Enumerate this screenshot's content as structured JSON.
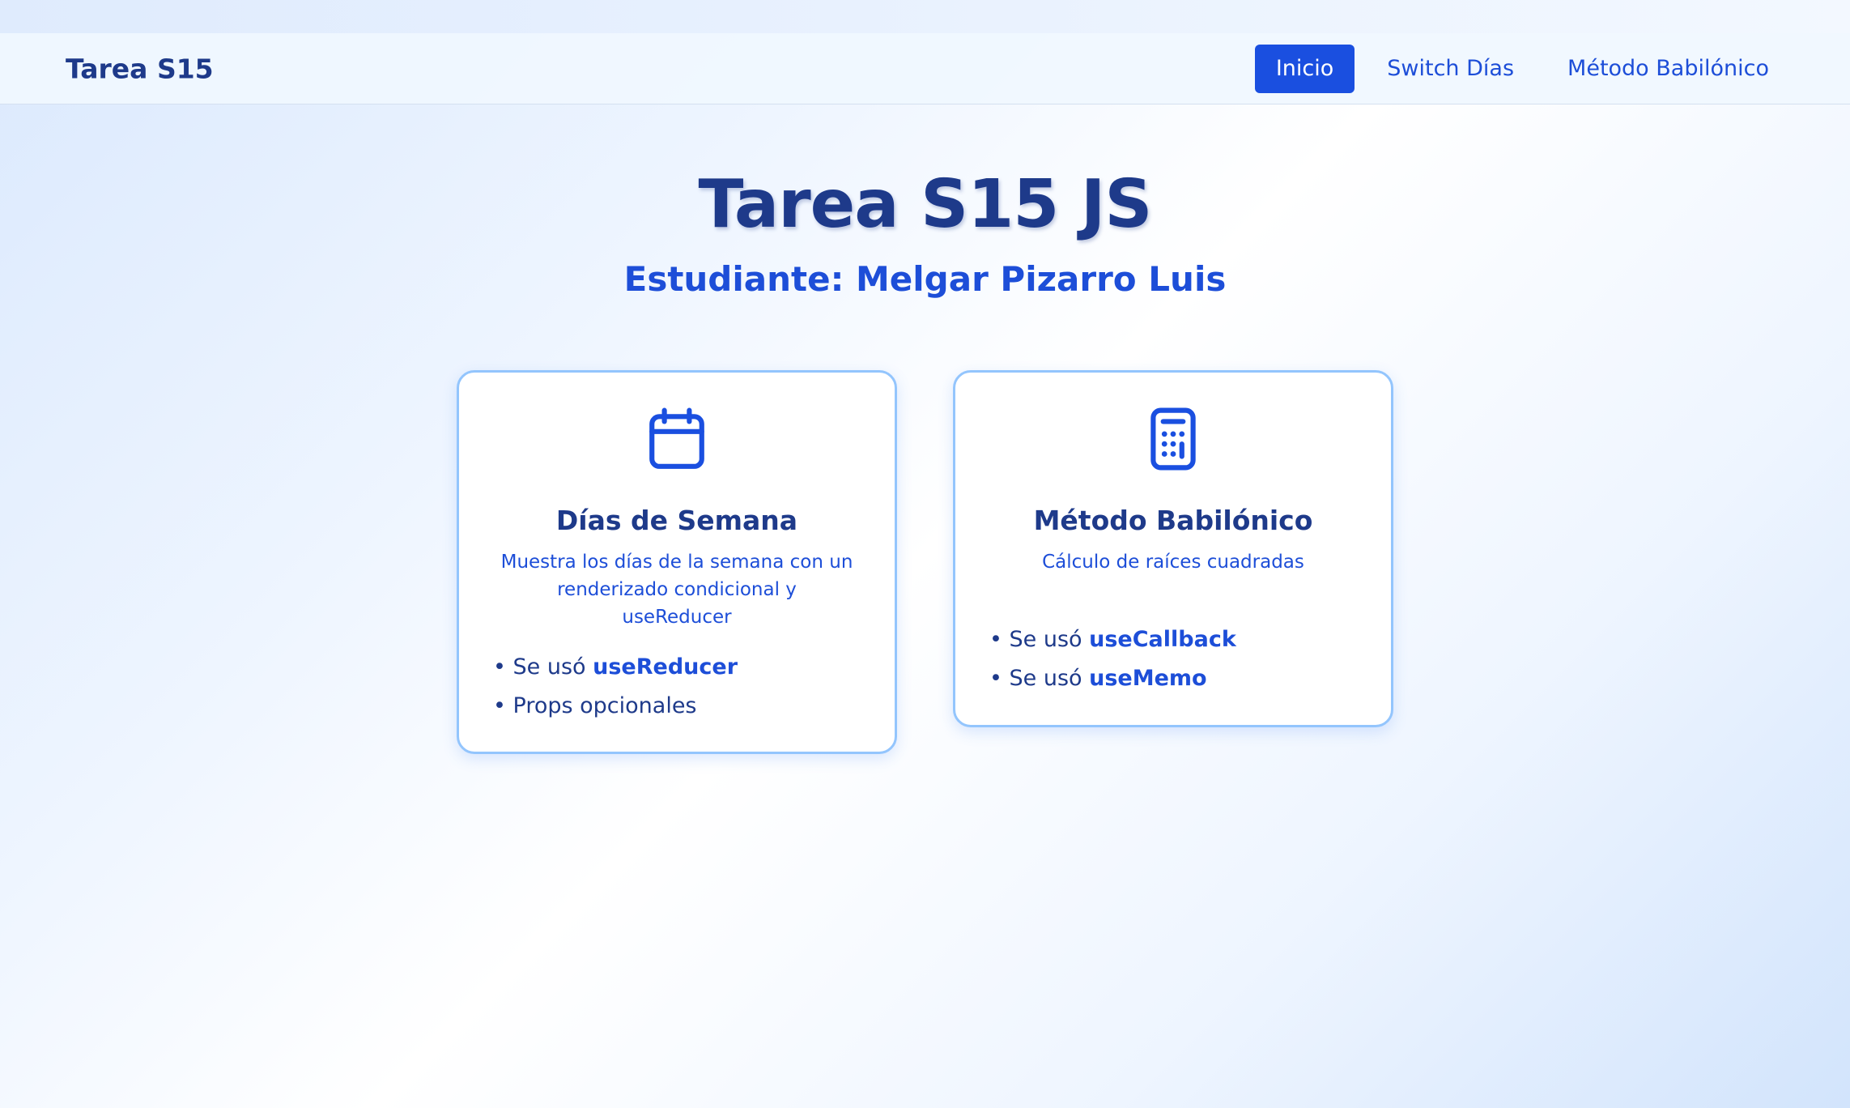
{
  "navbar": {
    "brand": "Tarea S15",
    "links": [
      {
        "label": "Inicio",
        "active": true
      },
      {
        "label": "Switch Días",
        "active": false
      },
      {
        "label": "Método Babilónico",
        "active": false
      }
    ]
  },
  "hero": {
    "title": "Tarea S15 JS",
    "subtitle": "Estudiante: Melgar Pizarro Luis"
  },
  "cards": [
    {
      "icon": "calendar-icon",
      "title": "Días de Semana",
      "description": "Muestra los días de la semana con un renderizado condicional y useReducer",
      "items": [
        {
          "bullet": "• ",
          "text": "Se usó ",
          "bold": "useReducer"
        },
        {
          "bullet": "• ",
          "text": "Props opcionales",
          "bold": ""
        }
      ]
    },
    {
      "icon": "calculator-icon",
      "title": "Método Babilónico",
      "description": "Cálculo de raíces cuadradas",
      "items": [
        {
          "bullet": "• ",
          "text": "Se usó ",
          "bold": "useCallback"
        },
        {
          "bullet": "• ",
          "text": "Se usó ",
          "bold": "useMemo"
        }
      ]
    }
  ],
  "colors": {
    "accent": "#1a4fe0",
    "heading": "#1e3a8a",
    "text": "#1d4ed8",
    "card_border": "#93c5fd"
  }
}
